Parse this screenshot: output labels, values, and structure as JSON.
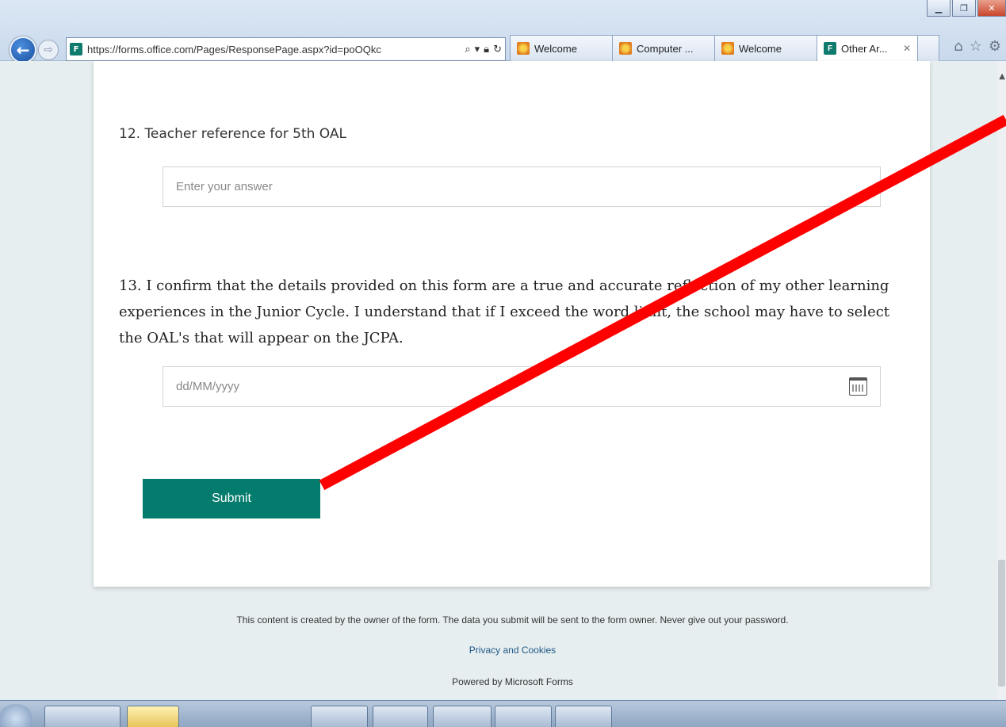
{
  "browser": {
    "url": "https://forms.office.com/Pages/ResponsePage.aspx?id=poOQkc",
    "tabs": [
      {
        "label": "Welcome",
        "icon": "sun-icon"
      },
      {
        "label": "Computer ...",
        "icon": "sun-icon"
      },
      {
        "label": "Welcome",
        "icon": "sun-icon"
      },
      {
        "label": "Other Ar...",
        "icon": "forms-icon",
        "active": true
      }
    ]
  },
  "form": {
    "q12": {
      "title": "12. Teacher reference for 5th OAL",
      "placeholder": "Enter your answer"
    },
    "q13": {
      "title": "13. I confirm that the details provided on this form are a true and accurate reflection of my other learning experiences in the Junior Cycle. I understand that if I exceed the word limit, the school may have to select the OAL's that will appear on the JCPA.",
      "placeholder": "dd/MM/yyyy"
    },
    "submit_label": "Submit"
  },
  "footer": {
    "note": "This content is created by the owner of the form. The data you submit will be sent to the form owner. Never give out your password.",
    "privacy_link": "Privacy and Cookies",
    "powered_by": "Powered by Microsoft Forms"
  },
  "colors": {
    "accent": "#047c6d",
    "annotation_arrow": "#ff0000",
    "page_bg": "#e6eef0"
  }
}
